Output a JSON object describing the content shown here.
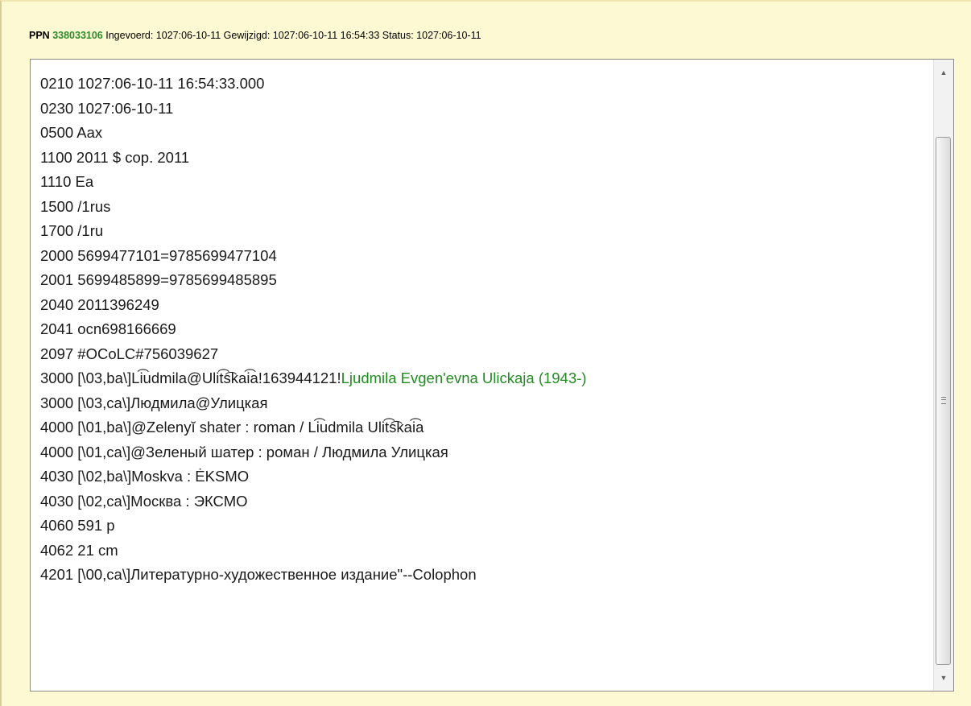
{
  "header": {
    "ppn_label": "PPN",
    "ppn_value": "338033106",
    "meta_text": "Ingevoerd: 1027:06-10-11 Gewijzigd: 1027:06-10-11 16:54:33 Status: 1027:06-10-11"
  },
  "record": {
    "lines": [
      "0210 1027:06-10-11 16:54:33.000",
      "0230 1027:06-10-11",
      "0500 Aax",
      "1100 2011 $ cop. 2011",
      "1110 Ea",
      "1500 /1rus",
      "1700 /1ru",
      "2000 5699477101=9785699477104",
      "2001 5699485899=9785699485895",
      "2040 2011396249",
      "2041 ocn698166669",
      "2097 #OCoLC#756039627",
      "3000 [\\03,ba\\]Li͡udmila@Ulit͡s͡kai͡a!163944121!",
      "3000 [\\03,ca\\]Людмила@Улицкая",
      "4000 [\\01,ba\\]@Zelenyĭ shater : roman / Li͡udmila Ulit͡s͡kai͡a",
      "4000 [\\01,ca\\]@Зеленый шатер : роман / Людмила Улицкая",
      "4030 [\\02,ba\\]Moskva : ĖKSMO",
      "4030 [\\02,ca\\]Москва : ЭКСМО",
      "4060 591 p",
      "4062 21 cm",
      "4201 [\\00,ca\\]Литературно-художественное издание\"--Colophon"
    ],
    "link_text": "Ljudmila Evgenʹevna Ulickaja (1943-)"
  },
  "icons": {
    "scroll_up": "triangle-up",
    "scroll_down": "triangle-down",
    "thumb_grip": "grip-lines"
  },
  "colors": {
    "panel_background": "#fdf9d3",
    "ppn_green": "#2e8b2e",
    "link_green": "#228b22"
  }
}
